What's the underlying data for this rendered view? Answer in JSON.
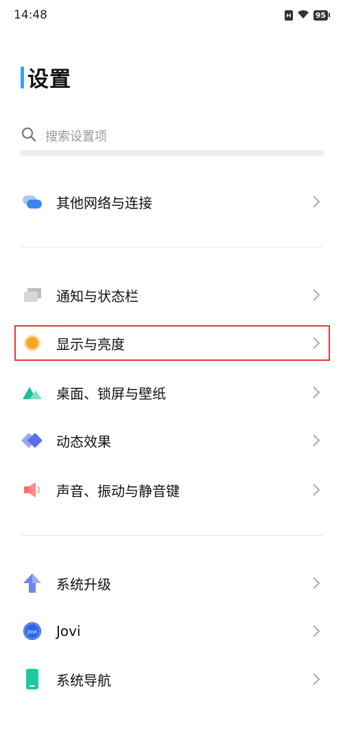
{
  "status_bar": {
    "time": "14:48",
    "battery": "95"
  },
  "page": {
    "title": "设置"
  },
  "search": {
    "placeholder": "搜索设置项"
  },
  "items": [
    {
      "label": "其他网络与连接",
      "icon": "cloud-network-icon"
    },
    {
      "label": "通知与状态栏",
      "icon": "notification-cards-icon"
    },
    {
      "label": "显示与亮度",
      "icon": "brightness-circle-icon"
    },
    {
      "label": "桌面、锁屏与壁纸",
      "icon": "mountain-wallpaper-icon"
    },
    {
      "label": "动态效果",
      "icon": "diamond-effects-icon"
    },
    {
      "label": "声音、振动与静音键",
      "icon": "speaker-icon"
    },
    {
      "label": "系统升级",
      "icon": "upgrade-arrow-icon"
    },
    {
      "label": "Jovi",
      "icon": "jovi-icon"
    },
    {
      "label": "系统导航",
      "icon": "phone-navigation-icon"
    }
  ],
  "colors": {
    "accent": "#3aa3f5",
    "highlight": "#e53935"
  }
}
